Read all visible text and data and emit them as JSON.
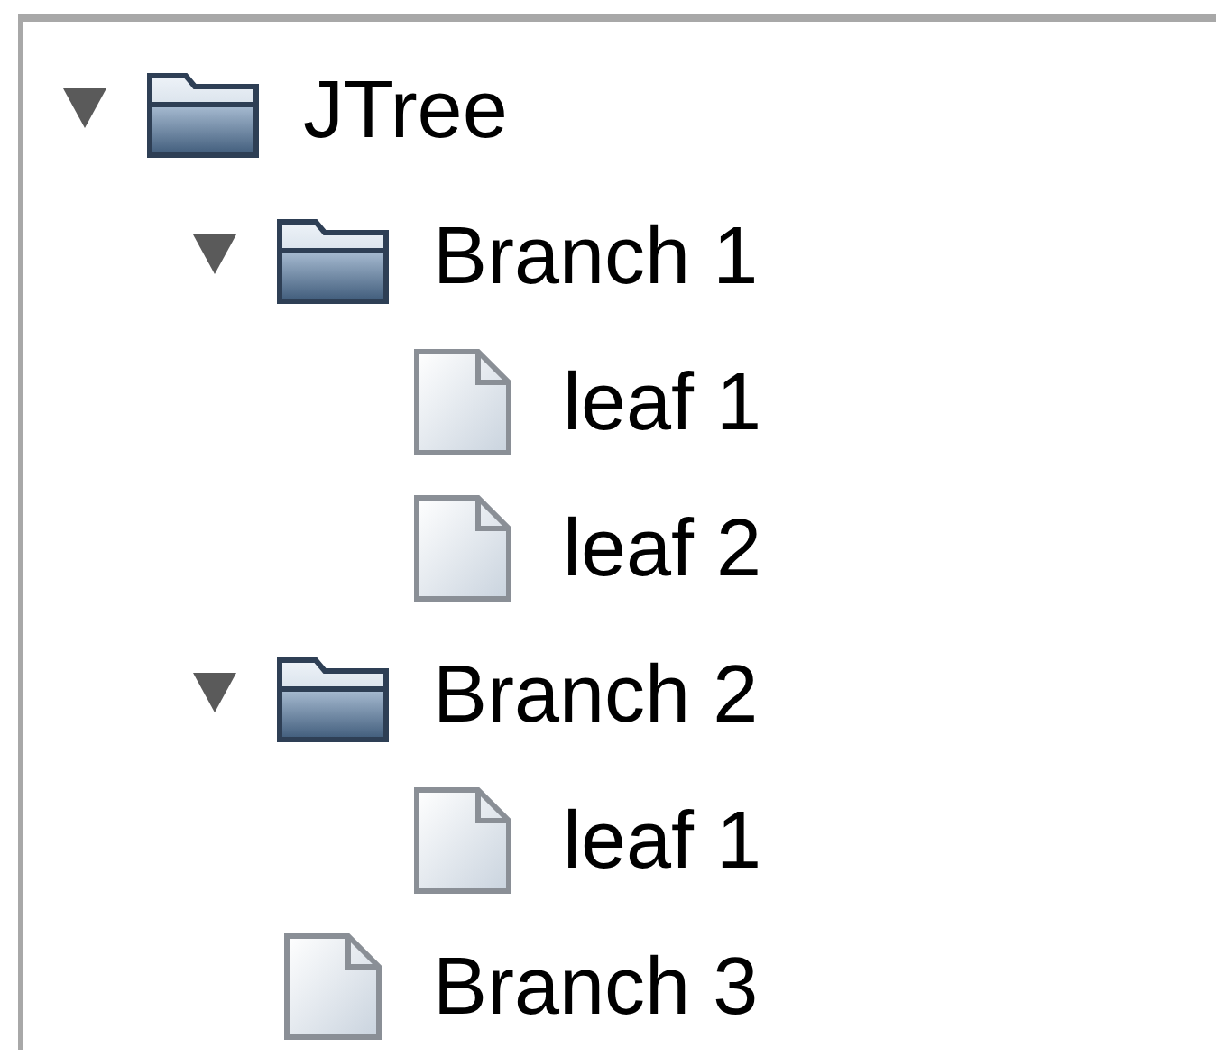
{
  "tree": {
    "root": {
      "label": "JTree",
      "kind": "folder",
      "expanded": true,
      "children": [
        {
          "label": "Branch 1",
          "kind": "folder",
          "expanded": true,
          "children": [
            {
              "label": "leaf 1",
              "kind": "leaf"
            },
            {
              "label": "leaf 2",
              "kind": "leaf"
            }
          ]
        },
        {
          "label": "Branch 2",
          "kind": "folder",
          "expanded": true,
          "children": [
            {
              "label": "leaf 1",
              "kind": "leaf"
            }
          ]
        },
        {
          "label": "Branch 3",
          "kind": "leaf"
        }
      ]
    }
  }
}
